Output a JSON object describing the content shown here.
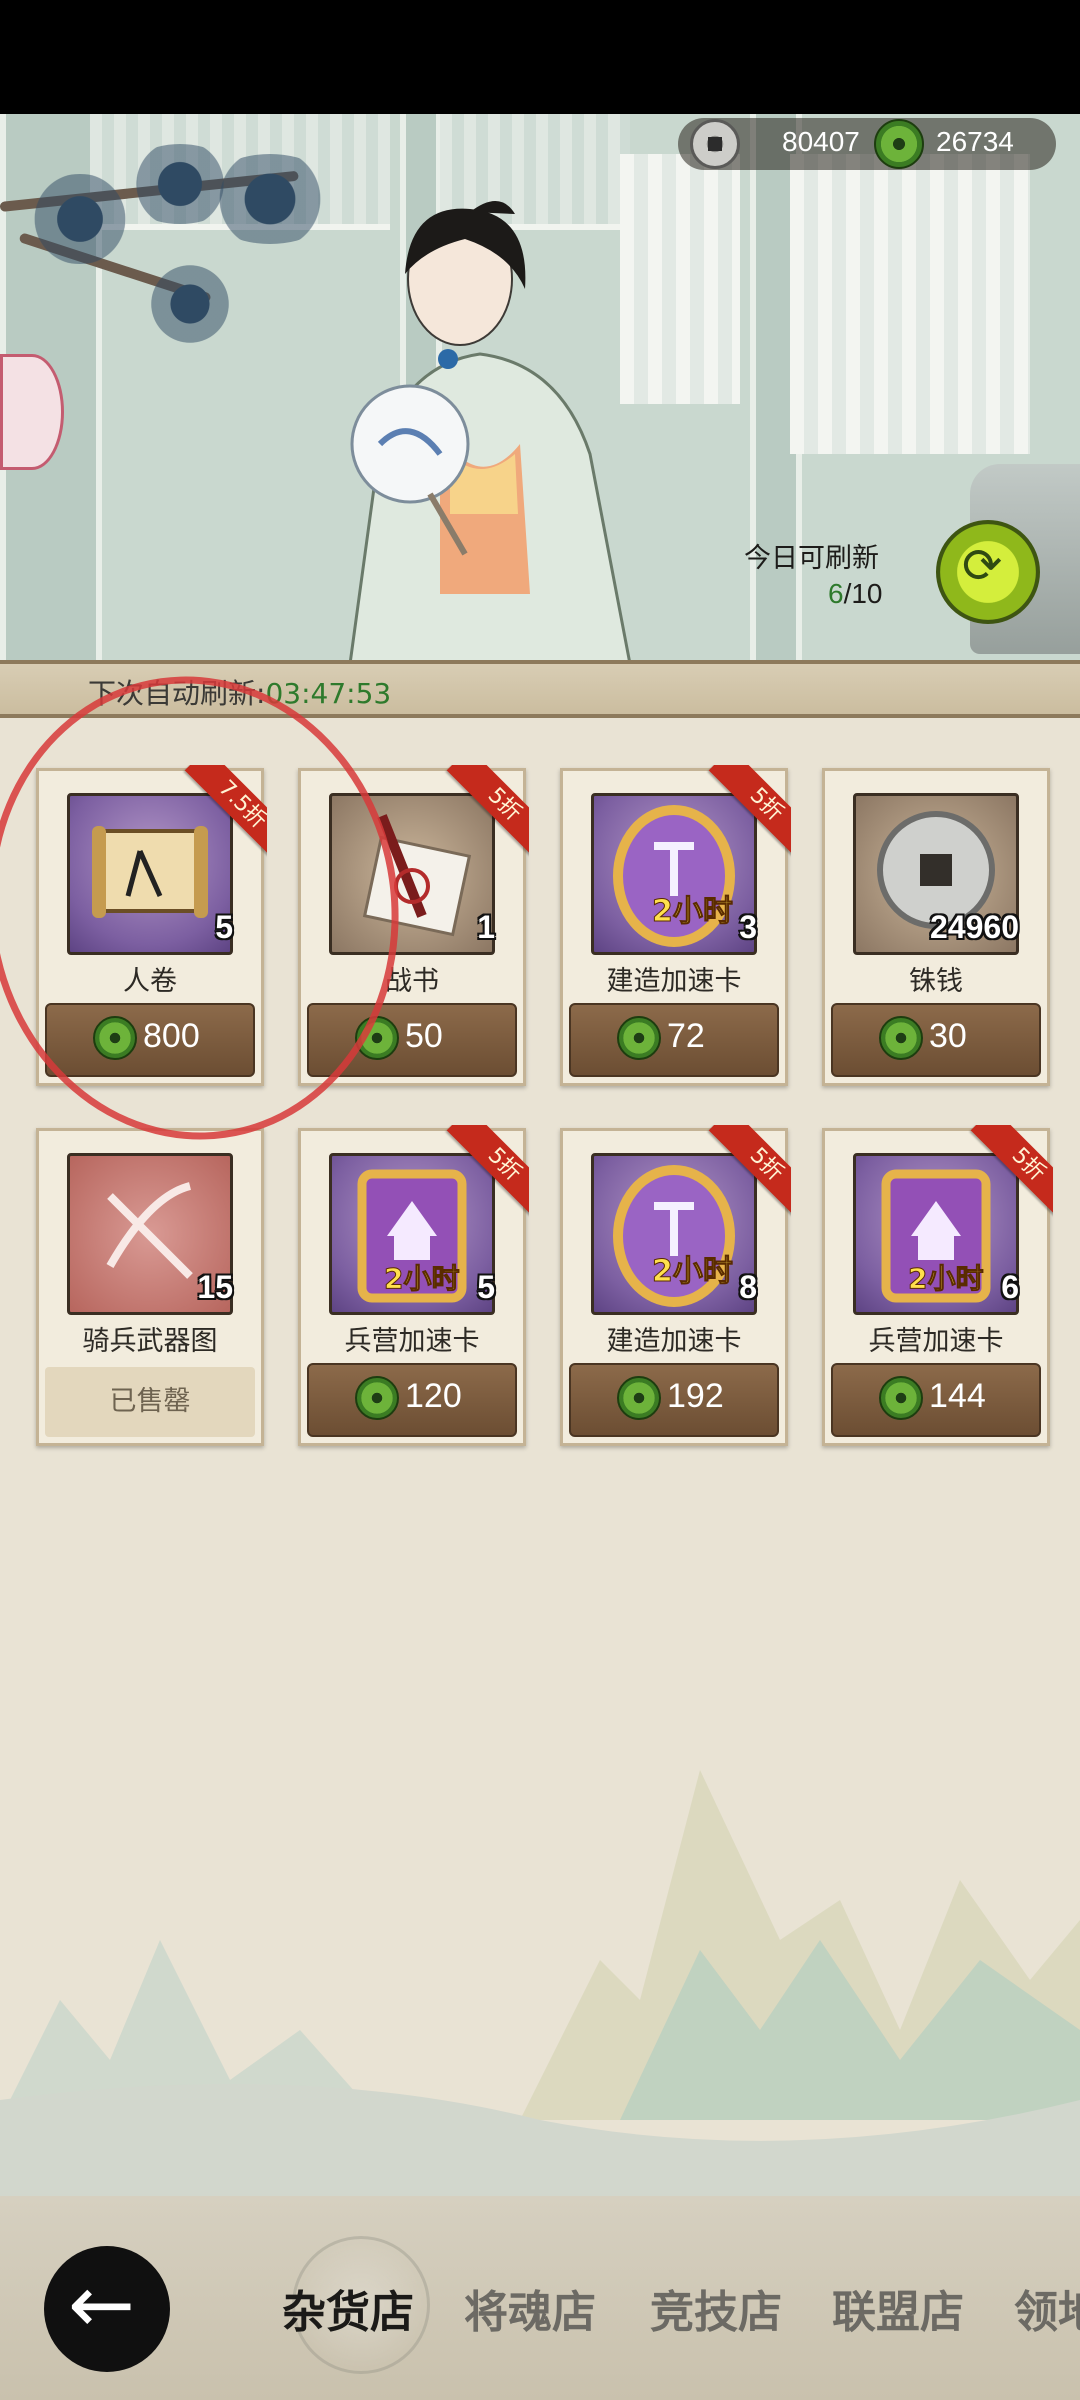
{
  "currency": {
    "copper": "80407",
    "jade": "26734"
  },
  "refresh": {
    "label": "今日可刷新",
    "remaining": "6",
    "total": "/10"
  },
  "timer": {
    "label": "下次自动刷新:",
    "value": "03:47:53"
  },
  "items": [
    {
      "name": "人卷",
      "qty": "5",
      "price": "800",
      "discount": "7.5折",
      "sold": false
    },
    {
      "name": "战书",
      "qty": "1",
      "price": "50",
      "discount": "5折",
      "sold": false
    },
    {
      "name": "建造加速卡",
      "qty": "3",
      "price": "72",
      "discount": "5折",
      "sold": false
    },
    {
      "name": "铢钱",
      "qty": "24960",
      "price": "30",
      "discount": "",
      "sold": false
    },
    {
      "name": "骑兵武器图",
      "qty": "15",
      "price": "",
      "discount": "",
      "sold": true,
      "sold_label": "已售罄"
    },
    {
      "name": "兵营加速卡",
      "qty": "5",
      "price": "120",
      "discount": "5折",
      "sold": false
    },
    {
      "name": "建造加速卡",
      "qty": "8",
      "price": "192",
      "discount": "5折",
      "sold": false
    },
    {
      "name": "兵营加速卡",
      "qty": "6",
      "price": "144",
      "discount": "5折",
      "sold": false
    }
  ],
  "card_icons": [
    "scroll-icon",
    "war-letter-icon",
    "build-speedup-icon",
    "coin-icon",
    "cavalry-weapon-icon",
    "barracks-speedup-icon",
    "build-speedup-icon",
    "barracks-speedup-icon"
  ],
  "card_labels": {
    "two_hours": "2小时"
  },
  "tabs": [
    "杂货店",
    "将魂店",
    "竞技店",
    "联盟店",
    "领地"
  ],
  "active_tab": "杂货店",
  "colors": {
    "discount_ribbon": "#c52a1c",
    "price_button": "#7a5b3e",
    "timer_value": "#2e7a2c",
    "annotation_circle": "#d73a3a"
  }
}
